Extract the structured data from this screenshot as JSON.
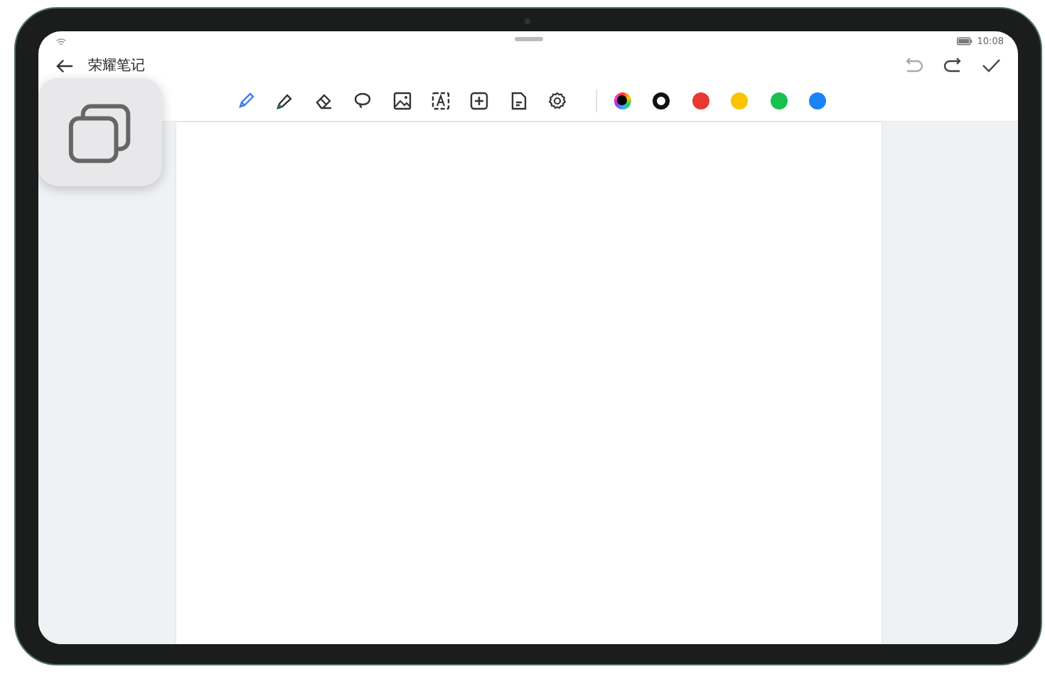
{
  "status_bar": {
    "time": "10:08"
  },
  "header": {
    "title": "荣耀笔记",
    "undo": {
      "disabled": true
    },
    "redo": {
      "disabled": false
    }
  },
  "tools": [
    {
      "kind": "pen",
      "selected": true
    },
    {
      "kind": "highlighter",
      "selected": false
    },
    {
      "kind": "eraser",
      "selected": false
    },
    {
      "kind": "lasso",
      "selected": false
    },
    {
      "kind": "image",
      "selected": false
    },
    {
      "kind": "text",
      "selected": false
    },
    {
      "kind": "add",
      "selected": false
    },
    {
      "kind": "document",
      "selected": false
    },
    {
      "kind": "settings",
      "selected": false
    }
  ],
  "colors": [
    {
      "kind": "palette",
      "selected": false
    },
    {
      "color": "#111111",
      "selected": true
    },
    {
      "color": "#e8382f",
      "selected": false
    },
    {
      "color": "#fcc400",
      "selected": false
    },
    {
      "color": "#18c04f",
      "selected": false
    },
    {
      "color": "#1a84f5",
      "selected": false
    }
  ]
}
